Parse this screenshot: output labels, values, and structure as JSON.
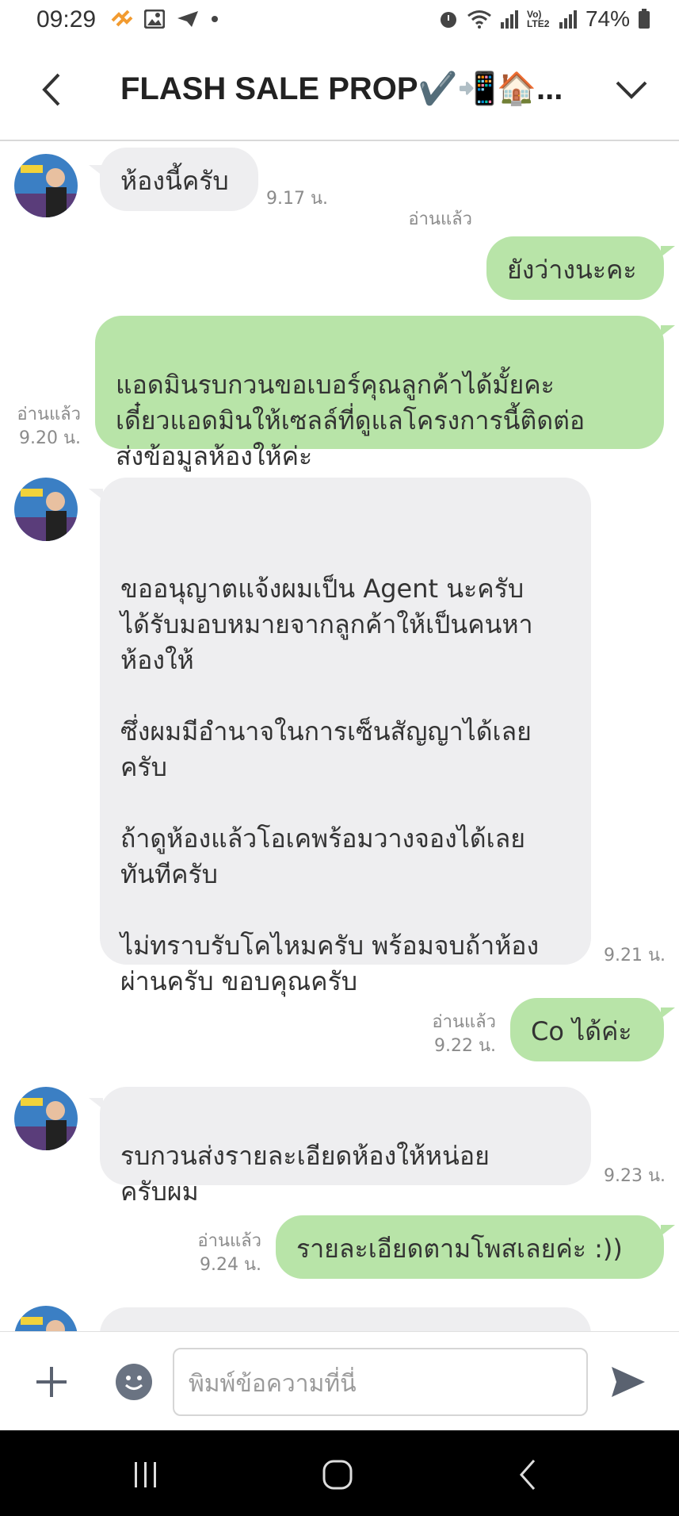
{
  "status_bar": {
    "time": "09:29",
    "battery": "74%",
    "network": "Vo) LTE2"
  },
  "header": {
    "title": "FLASH SALE PROP✔️📲🏠..."
  },
  "messages": [
    {
      "side": "in",
      "text": "ห้องนี้ครับ",
      "time": "9.17 น."
    },
    {
      "side": "out",
      "text": "ยังว่างนะคะ",
      "read": "อ่านแล้ว",
      "time": ""
    },
    {
      "side": "out",
      "text": "แอดมินรบกวนขอเบอร์คุณลูกค้าได้มั้ยคะ\nเดี๋ยวแอดมินให้เซลล์ที่ดูแลโครงการนี้ติดต่อ\nส่งข้อมูลห้องให้ค่ะ",
      "read": "อ่านแล้ว",
      "time": "9.20 น."
    },
    {
      "side": "in",
      "text": "\nขออนุญาตแจ้งผมเป็น Agent นะครับ\nได้รับมอบหมายจากลูกค้าให้เป็นคนหา\nห้องให้\n\nซึ่งผมมีอำนาจในการเซ็นสัญญาได้เลย\nครับ\n\nถ้าดูห้องแล้วโอเคพร้อมวางจองได้เลย\nทันทีครับ\n\nไม่ทราบรับโคไหมครับ พร้อมจบถ้าห้อง\nผ่านครับ ขอบคุณครับ",
      "time": "9.21 น."
    },
    {
      "side": "out",
      "text": "Co ได้ค่ะ",
      "read": "อ่านแล้ว",
      "time": "9.22 น."
    },
    {
      "side": "in",
      "text": "รบกวนส่งรายละเอียดห้องให้หน่อย\nครับผม",
      "time": "9.23 น."
    },
    {
      "side": "out",
      "text": "รายละเอียดตามโพสเลยค่ะ :))",
      "read": "อ่านแล้ว",
      "time": "9.24 น."
    }
  ],
  "input": {
    "placeholder": "พิมพ์ข้อความที่นี่"
  },
  "colors": {
    "outgoing_bubble": "#b8e4a8",
    "incoming_bubble": "#eeeef0",
    "meta_text": "#8b8b8b"
  },
  "icons": [
    "back-icon",
    "chevron-down-icon",
    "plus-icon",
    "emoji-icon",
    "send-icon",
    "recent-apps-icon",
    "home-icon",
    "nav-back-icon"
  ]
}
